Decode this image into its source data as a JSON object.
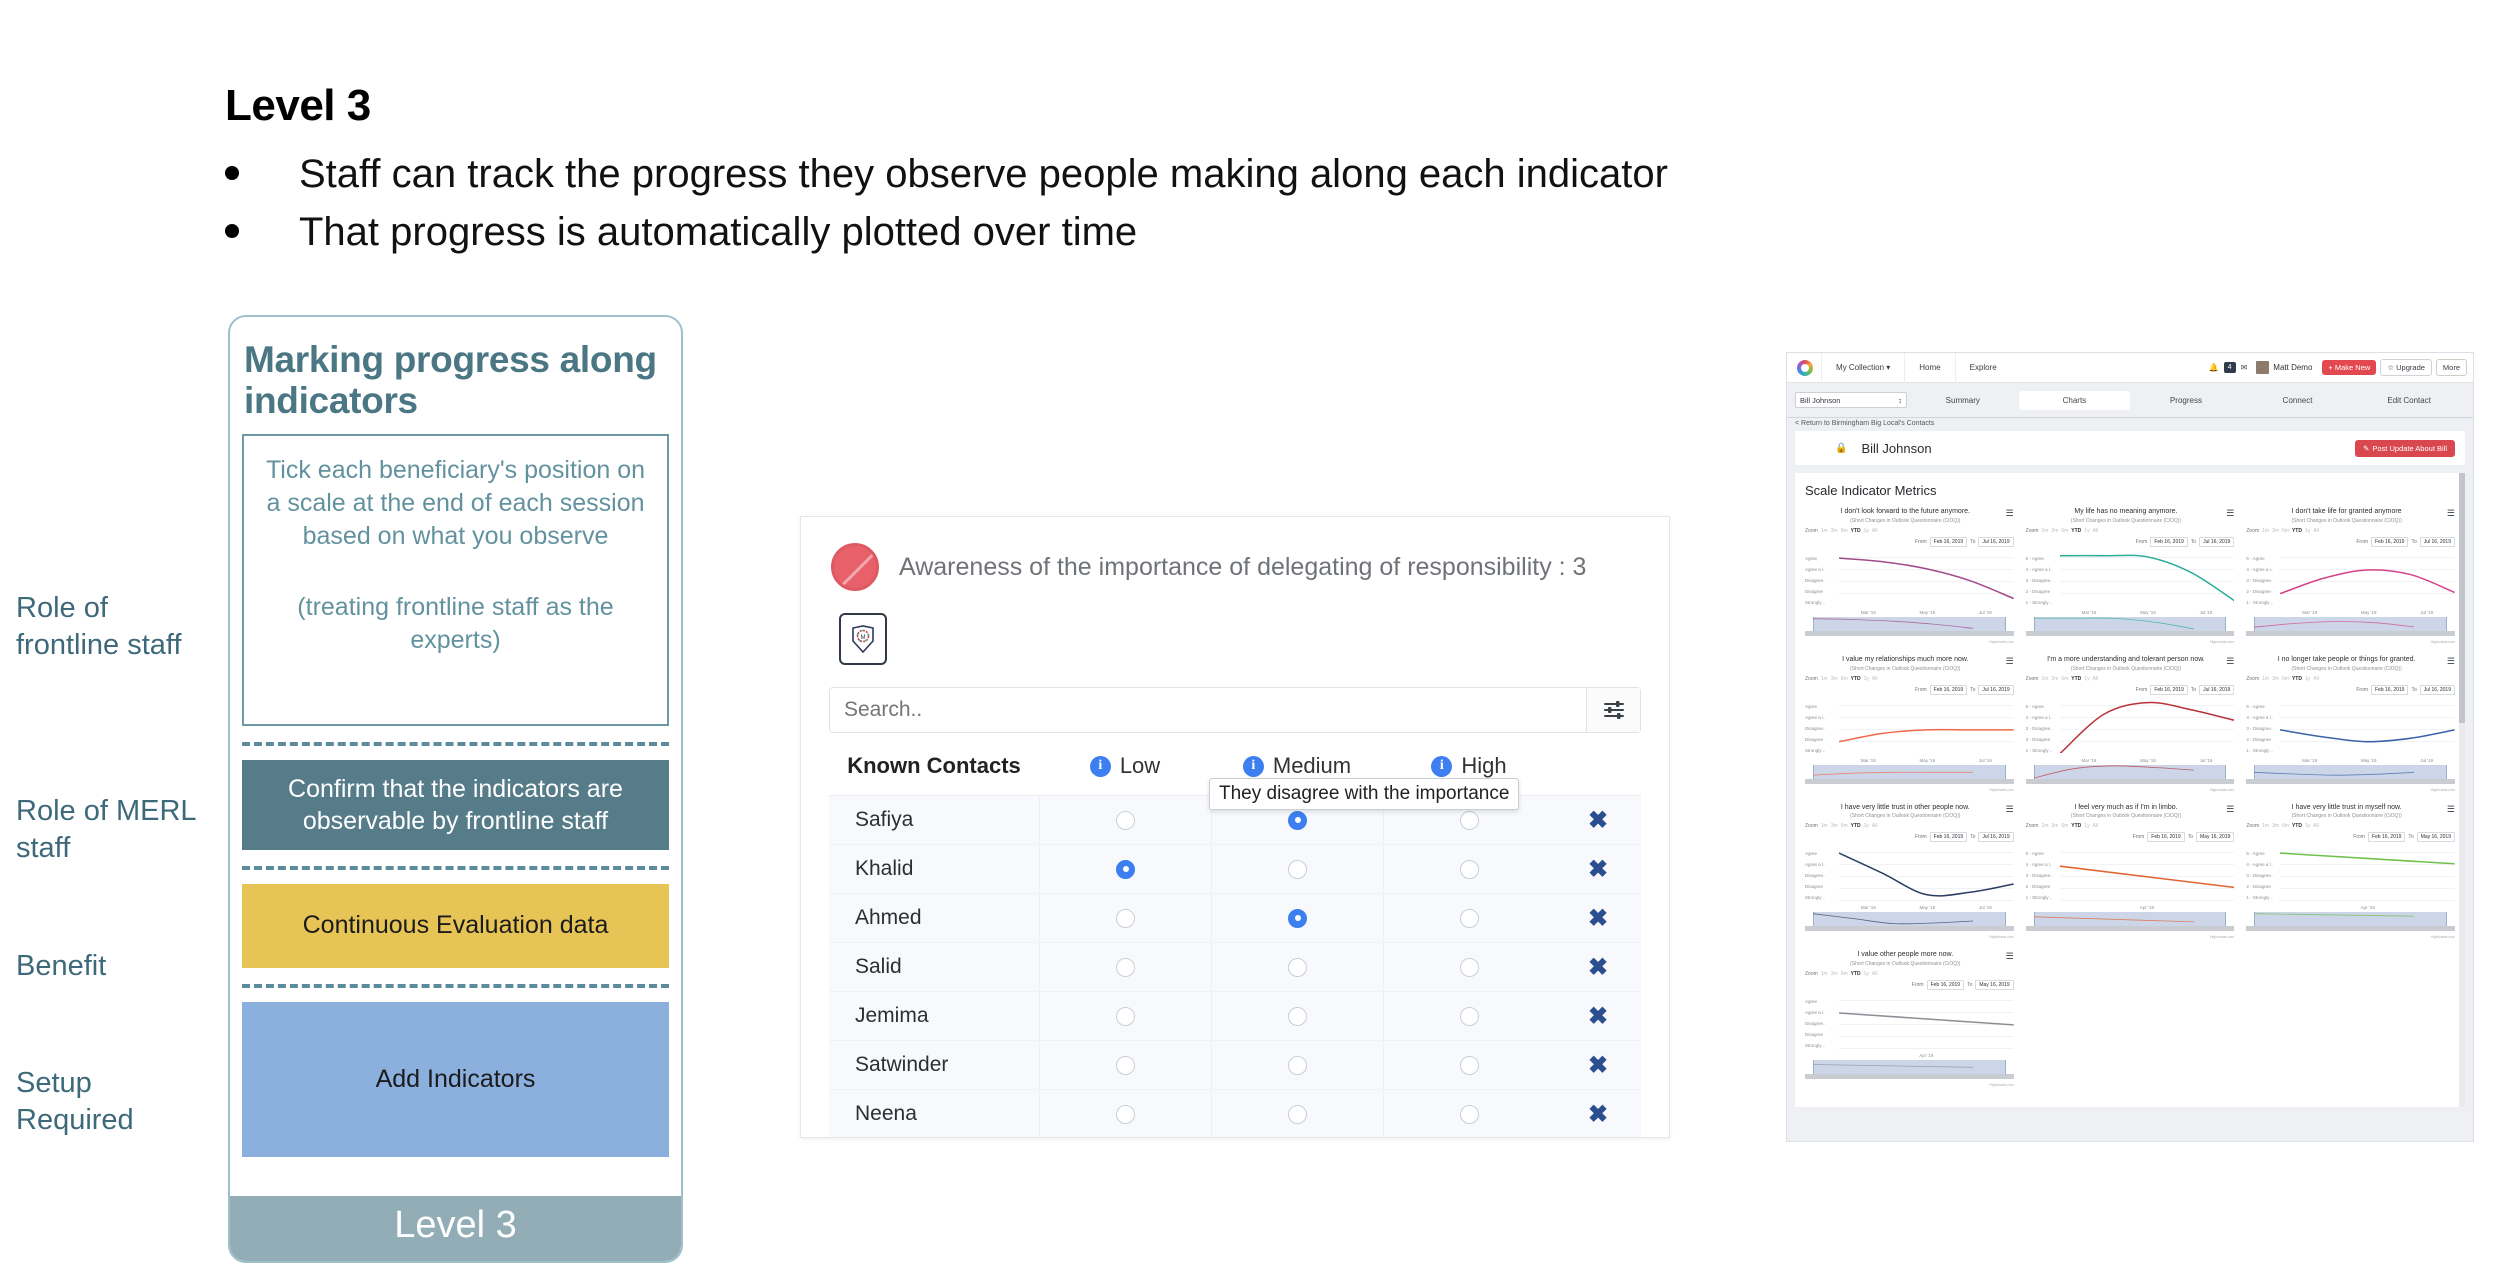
{
  "slide": {
    "title": "Level 3",
    "bullets": [
      "Staff can track the progress they observe people making along each indicator",
      "That progress is automatically plotted over time"
    ]
  },
  "legend": {
    "frontline": "Role of frontline staff",
    "merl": "Role of MERL staff",
    "benefit": "Benefit",
    "setup": "Setup Required"
  },
  "card": {
    "title": "Marking progress along indicators",
    "description_1": "Tick each beneficiary's position on a scale at the end of each session based on what you observe",
    "description_2": "(treating frontline staff as the experts)",
    "merl_block": "Confirm that the indicators are observable by frontline staff",
    "benefit_block": "Continuous Evaluation data",
    "setup_block": "Add Indicators",
    "footer": "Level 3",
    "colors": {
      "border": "#9dc0cb",
      "merl": "#567c89",
      "benefit": "#e6c556",
      "setup": "#8cb0dd",
      "footer": "#93adb6"
    }
  },
  "survey": {
    "title": "Awareness of the importance of delegating of responsibility : 3",
    "badge_icon": "red-circle-icon",
    "shield_icon": "shield-badge-icon",
    "search_placeholder": "Search..",
    "search_value": "",
    "filter_icon": "filter-sliders-icon",
    "tooltip": "They disagree with the importance",
    "columns": [
      "Known Contacts",
      "Low",
      "Medium",
      "High"
    ],
    "rows": [
      {
        "name": "Safiya",
        "selected": "Medium"
      },
      {
        "name": "Khalid",
        "selected": "Low"
      },
      {
        "name": "Ahmed",
        "selected": "Medium"
      },
      {
        "name": "Salid",
        "selected": ""
      },
      {
        "name": "Jemima",
        "selected": ""
      },
      {
        "name": "Satwinder",
        "selected": ""
      },
      {
        "name": "Neena",
        "selected": ""
      }
    ],
    "delete_icon": "close-x-icon",
    "accent": "#3d7ff0"
  },
  "dashboard": {
    "logo": "rainbow-ring-logo",
    "topnav": [
      "My Collection ▾",
      "Home",
      "Explore"
    ],
    "notif_count": "4",
    "user_name": "Matt Demo",
    "buttons": {
      "make_new": "+ Make New",
      "upgrade": "☆ Upgrade",
      "more": "More"
    },
    "contact_select": "Bill Johnson",
    "tabs": [
      {
        "label": "Summary",
        "active": false
      },
      {
        "label": "Charts",
        "active": true
      },
      {
        "label": "Progress",
        "active": false
      },
      {
        "label": "Connect",
        "active": false
      },
      {
        "label": "Edit Contact",
        "active": false
      }
    ],
    "breadcrumb": "< Return to Birmingham Big Local's Contacts",
    "contact_name": "Bill Johnson",
    "post_update_button": "Post Update About Bill",
    "metrics_title": "Scale Indicator Metrics",
    "zoom_label": "Zoom",
    "zoom_options": [
      "1m",
      "3m",
      "6m",
      "YTD",
      "1y",
      "All"
    ],
    "zoom_selected": "YTD",
    "from_label": "From",
    "to_label": "To",
    "credit": "Highcharts.com",
    "questionnaire": "(Short Changes in Outlook Questionnaire (CiOQ))"
  },
  "chart_data": [
    {
      "type": "line",
      "title": "I don't look forward to the future anymore.",
      "subtitle": "(Short Changes in Outlook Questionnaire (CiOQ))",
      "from": "Feb 16, 2019",
      "to": "Jul 16, 2019",
      "color": "#a04a8c",
      "ylabel": "",
      "xlabel": "",
      "ytick_labels": [
        "Agree",
        "Agree a l..",
        "Disagree..",
        "Disagree",
        "Strongly .."
      ],
      "xtick_labels": [
        "Mar '19",
        "May '19",
        "Jul '19"
      ],
      "ylim": [
        1,
        5
      ],
      "x": [
        0,
        0.25,
        0.5,
        0.75,
        1.0
      ],
      "values": [
        5.0,
        4.7,
        4.1,
        3.1,
        1.6
      ]
    },
    {
      "type": "line",
      "title": "My life has no meaning anymore.",
      "subtitle": "(Short Changes in Outlook Questionnaire (CiOQ))",
      "from": "Feb 16, 2019",
      "to": "Jul 16, 2019",
      "color": "#2fae9b",
      "ytick_labels": [
        "5 - Agree",
        "4 - Agree a l..",
        "3 - Disagree..",
        "2 - Disagree",
        "1 - Strongly .."
      ],
      "xtick_labels": [
        "Mar '19",
        "May '19",
        "Jul '19"
      ],
      "ylim": [
        1,
        5
      ],
      "x": [
        0,
        0.25,
        0.5,
        0.75,
        1.0
      ],
      "values": [
        5.2,
        5.2,
        5.1,
        3.8,
        1.4
      ]
    },
    {
      "type": "line",
      "title": "I don't take life for granted anymore",
      "subtitle": "(Short Changes in Outlook Questionnaire (CiOQ))",
      "from": "Feb 16, 2019",
      "to": "Jul 16, 2019",
      "color": "#d6418c",
      "ytick_labels": [
        "5 - Agree",
        "4 - Agree a l..",
        "3 - Disagree..",
        "2 - Disagree",
        "1 - Strongly .."
      ],
      "xtick_labels": [
        "Mar '19",
        "May '19",
        "Jul '19"
      ],
      "ylim": [
        1,
        5
      ],
      "x": [
        0,
        0.25,
        0.5,
        0.75,
        1.0
      ],
      "values": [
        2.0,
        3.3,
        4.0,
        3.6,
        2.1
      ]
    },
    {
      "type": "line",
      "title": "I value my relationships much more now.",
      "subtitle": "(Short Changes in Outlook Questionnaire (CiOQ))",
      "from": "Feb 16, 2019",
      "to": "Jul 16, 2019",
      "color": "#ef6a4c",
      "ytick_labels": [
        "Agree",
        "Agree a l..",
        "Disagree..",
        "Disagree",
        "Strongly .."
      ],
      "xtick_labels": [
        "Mar '19",
        "May '19",
        "Jul '19"
      ],
      "ylim": [
        1,
        5
      ],
      "x": [
        0,
        0.25,
        0.5,
        0.75,
        1.0
      ],
      "values": [
        2.0,
        2.7,
        3.0,
        3.0,
        3.0
      ]
    },
    {
      "type": "line",
      "title": "I'm a more understanding and tolerant person now.",
      "subtitle": "(Short Changes in Outlook Questionnaire (CiOQ))",
      "from": "Feb 16, 2019",
      "to": "Jul 16, 2019",
      "color": "#b8343a",
      "ytick_labels": [
        "5 - Agree",
        "4 - Agree a l..",
        "3 - Disagree..",
        "2 - Disagree",
        "1 - Strongly .."
      ],
      "xtick_labels": [
        "Mar '19",
        "May '19",
        "Jul '19"
      ],
      "ylim": [
        1,
        5
      ],
      "x": [
        0,
        0.25,
        0.5,
        0.75,
        1.0
      ],
      "values": [
        1.0,
        4.3,
        5.3,
        4.7,
        3.8
      ]
    },
    {
      "type": "line",
      "title": "I no longer take people or things for granted.",
      "subtitle": "(Short Changes in Outlook Questionnaire (CiOQ))",
      "from": "Feb 16, 2019",
      "to": "Jul 16, 2019",
      "color": "#3b63a8",
      "ytick_labels": [
        "5 - Agree",
        "4 - Agree a l..",
        "3 - Disagree..",
        "2 - Disagree",
        "1 - Strongly .."
      ],
      "xtick_labels": [
        "Mar '19",
        "May '19",
        "Jul '19"
      ],
      "ylim": [
        1,
        5
      ],
      "x": [
        0,
        0.25,
        0.5,
        0.75,
        1.0
      ],
      "values": [
        3.0,
        2.4,
        2.0,
        2.3,
        3.0
      ]
    },
    {
      "type": "line",
      "title": "I have very little trust in other people now.",
      "subtitle": "(Short Changes in Outlook Questionnaire (CiOQ))",
      "from": "Feb 16, 2019",
      "to": "Jul 16, 2019",
      "color": "#2c3e63",
      "ytick_labels": [
        "Agree",
        "Agree a l..",
        "Disagree..",
        "Disagree",
        "Strongly .."
      ],
      "xtick_labels": [
        "Mar '19",
        "May '19",
        "Jul '19"
      ],
      "ylim": [
        1,
        5
      ],
      "x": [
        0,
        0.25,
        0.5,
        0.75,
        1.0
      ],
      "values": [
        5.0,
        3.3,
        1.5,
        1.7,
        2.4
      ]
    },
    {
      "type": "line",
      "title": "I feel very much as if I'm in limbo.",
      "subtitle": "(Short Changes in Outlook Questionnaire (CiOQ))",
      "from": "Feb 16, 2019",
      "to": "May 16, 2019",
      "color": "#e2622f",
      "ytick_labels": [
        "5 - Agree",
        "4 - Agree a l..",
        "3 - Disagree..",
        "2 - Disagree",
        "1 - Strongly .."
      ],
      "xtick_labels": [
        "Apr '19"
      ],
      "ylim": [
        1,
        5
      ],
      "x": [
        0,
        1.0
      ],
      "values": [
        3.9,
        2.1
      ]
    },
    {
      "type": "line",
      "title": "I have very little trust in myself now.",
      "subtitle": "(Short Changes in Outlook Questionnaire (CiOQ))",
      "from": "Feb 16, 2019",
      "to": "May 16, 2019",
      "color": "#6fc14a",
      "ytick_labels": [
        "5 - Agree",
        "4 - Agree a l..",
        "3 - Disagree..",
        "2 - Disagree",
        "1 - Strongly .."
      ],
      "xtick_labels": [
        "Apr '19"
      ],
      "ylim": [
        1,
        5
      ],
      "x": [
        0,
        1.0
      ],
      "values": [
        5.0,
        4.1
      ]
    },
    {
      "type": "line",
      "title": "I value other people more now.",
      "subtitle": "(Short Changes in Outlook Questionnaire (CiOQ))",
      "from": "Feb 16, 2019",
      "to": "May 16, 2019",
      "color": "#8b8f95",
      "ytick_labels": [
        "Agree",
        "Agree a l..",
        "Disagree..",
        "Disagree",
        "Strongly .."
      ],
      "xtick_labels": [
        "Apr '19"
      ],
      "ylim": [
        1,
        5
      ],
      "x": [
        0,
        1.0
      ],
      "values": [
        4.0,
        3.0
      ]
    }
  ]
}
